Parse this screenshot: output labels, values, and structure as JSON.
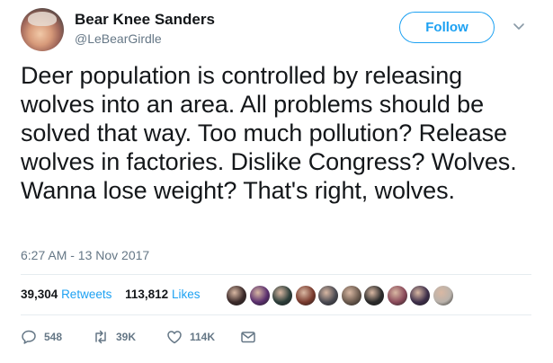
{
  "user": {
    "name": "Bear Knee Sanders",
    "handle": "@LeBearGirdle"
  },
  "follow_label": "Follow",
  "tweet": {
    "text": "Deer population is controlled by releasing wolves into an area. All problems should be solved that way. Too much pollution? Release wolves in factories. Dislike Congress? Wolves. Wanna lose weight? That's right, wolves.",
    "timestamp": "6:27 AM - 13 Nov 2017"
  },
  "stats": {
    "retweets_count": "39,304",
    "retweets_label": "Retweets",
    "likes_count": "113,812",
    "likes_label": "Likes"
  },
  "likers": [
    "#3b2a2a",
    "#5a2f6e",
    "#2c3e3a",
    "#7a3b2e",
    "#4a4a52",
    "#6b5a4e",
    "#2b2b2b",
    "#8a4a5a",
    "#3e2f4a",
    "#b9b2ab"
  ],
  "actions": {
    "reply_count": "548",
    "retweet_count": "39K",
    "like_count": "114K"
  },
  "colors": {
    "accent": "#1da1f2",
    "secondary_text": "#657786",
    "divider": "#e6ecf0"
  },
  "icons": {
    "reply": "reply-icon",
    "retweet": "retweet-icon",
    "like": "heart-icon",
    "dm": "envelope-icon",
    "menu": "chevron-down-icon"
  }
}
